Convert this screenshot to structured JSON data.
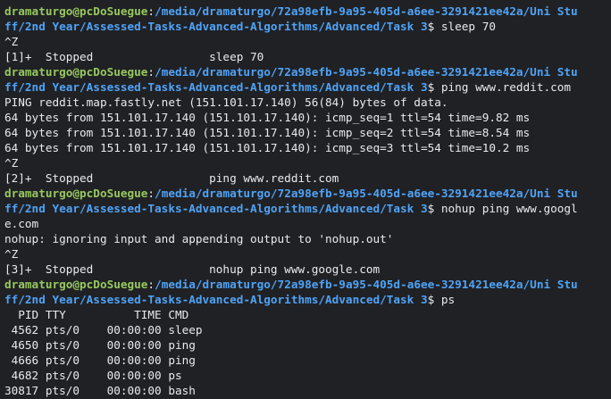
{
  "colors": {
    "background": "#202124",
    "prompt_user": "#97c95f",
    "prompt_path": "#4fa3f7",
    "text": "#e8eaed"
  },
  "terminal": {
    "lines": [
      {
        "type": "prompt",
        "user": "dramaturgo@pcDoSuegue",
        "sep": ":",
        "path": "/media/dramaturgo/72a98efb-9a95-405d-a6ee-3291421ee42a/Uni Stu",
        "dollar": "",
        "cmd": ""
      },
      {
        "type": "prompt",
        "user": "",
        "sep": "",
        "path": "ff/2nd Year/Assessed-Tasks-Advanced-Algorithms/Advanced/Task 3",
        "dollar": "$ ",
        "cmd": "sleep 70"
      },
      {
        "type": "output",
        "text": "^Z"
      },
      {
        "type": "output",
        "text": "[1]+  Stopped                 sleep 70"
      },
      {
        "type": "prompt",
        "user": "dramaturgo@pcDoSuegue",
        "sep": ":",
        "path": "/media/dramaturgo/72a98efb-9a95-405d-a6ee-3291421ee42a/Uni Stu",
        "dollar": "",
        "cmd": ""
      },
      {
        "type": "prompt",
        "user": "",
        "sep": "",
        "path": "ff/2nd Year/Assessed-Tasks-Advanced-Algorithms/Advanced/Task 3",
        "dollar": "$ ",
        "cmd": "ping www.reddit.com"
      },
      {
        "type": "output",
        "text": "PING reddit.map.fastly.net (151.101.17.140) 56(84) bytes of data."
      },
      {
        "type": "output",
        "text": "64 bytes from 151.101.17.140 (151.101.17.140): icmp_seq=1 ttl=54 time=9.82 ms"
      },
      {
        "type": "output",
        "text": "64 bytes from 151.101.17.140 (151.101.17.140): icmp_seq=2 ttl=54 time=8.54 ms"
      },
      {
        "type": "output",
        "text": "64 bytes from 151.101.17.140 (151.101.17.140): icmp_seq=3 ttl=54 time=10.2 ms"
      },
      {
        "type": "output",
        "text": "^Z"
      },
      {
        "type": "output",
        "text": "[2]+  Stopped                 ping www.reddit.com"
      },
      {
        "type": "prompt",
        "user": "dramaturgo@pcDoSuegue",
        "sep": ":",
        "path": "/media/dramaturgo/72a98efb-9a95-405d-a6ee-3291421ee42a/Uni Stu",
        "dollar": "",
        "cmd": ""
      },
      {
        "type": "prompt",
        "user": "",
        "sep": "",
        "path": "ff/2nd Year/Assessed-Tasks-Advanced-Algorithms/Advanced/Task 3",
        "dollar": "$ ",
        "cmd": "nohup ping www.googl"
      },
      {
        "type": "output",
        "text": "e.com"
      },
      {
        "type": "output",
        "text": "nohup: ignoring input and appending output to 'nohup.out'"
      },
      {
        "type": "output",
        "text": "^Z"
      },
      {
        "type": "output",
        "text": "[3]+  Stopped                 nohup ping www.google.com"
      },
      {
        "type": "prompt",
        "user": "dramaturgo@pcDoSuegue",
        "sep": ":",
        "path": "/media/dramaturgo/72a98efb-9a95-405d-a6ee-3291421ee42a/Uni Stu",
        "dollar": "",
        "cmd": ""
      },
      {
        "type": "prompt",
        "user": "",
        "sep": "",
        "path": "ff/2nd Year/Assessed-Tasks-Advanced-Algorithms/Advanced/Task 3",
        "dollar": "$ ",
        "cmd": "ps"
      },
      {
        "type": "output",
        "text": "  PID TTY          TIME CMD"
      },
      {
        "type": "output",
        "text": " 4562 pts/0    00:00:00 sleep"
      },
      {
        "type": "output",
        "text": " 4650 pts/0    00:00:00 ping"
      },
      {
        "type": "output",
        "text": " 4666 pts/0    00:00:00 ping"
      },
      {
        "type": "output",
        "text": " 4682 pts/0    00:00:00 ps"
      },
      {
        "type": "output",
        "text": "30817 pts/0    00:00:00 bash"
      }
    ]
  }
}
